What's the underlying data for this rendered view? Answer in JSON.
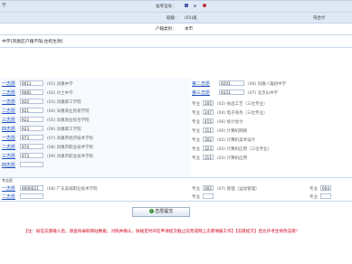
{
  "header": {
    "field1_suffix": "学",
    "exam_no_label": "准考证号：",
    "class_label": "班级：",
    "class_value": "(01)班",
    "hukou_label": "户籍类别：",
    "hukou_value": "本市",
    "subsidy_label": "符合计",
    "region_text": "中学(凤凰区户籍不限,住校生除)"
  },
  "tiers": [
    {
      "label": "一志愿",
      "code": "9011",
      "school": "(01) 凤凰中学"
    },
    {
      "label": "二志愿",
      "code": "9081",
      "school": "(02) 兴土中学"
    },
    {
      "label": "一志愿",
      "code": "920",
      "school": "(03) 凤凰职工学院"
    },
    {
      "label": "二志愿",
      "code": "921",
      "school": "(04) 凤凰商业贸易学院"
    },
    {
      "label": "三志愿",
      "code": "922",
      "school": "(05) 凤凰商业综合学院"
    },
    {
      "label": "四志愿",
      "code": "923",
      "school": "(06) 凤凰职工学院"
    },
    {
      "label": "一志愿",
      "code": "973",
      "school": "(07) 凤凰市经济技术学校"
    },
    {
      "label": "二志愿",
      "code": "974",
      "school": "(08) 凤凰市职业技术学校"
    },
    {
      "label": "三志愿",
      "code": "973",
      "school": "(09) 凤凰市职业技术学校"
    },
    {
      "label": "四志愿",
      "code": "",
      "school": ""
    }
  ],
  "right_tiers": [
    {
      "label": "第二志愿",
      "code": "9201",
      "school": "(06) 凤凰八雄初中学"
    },
    {
      "label": "第三志愿",
      "code": "9331",
      "school": "(07) 北京山中学"
    }
  ],
  "majors": [
    {
      "prefix": "专业",
      "num": "205",
      "name": "(02) 食品工艺（三位专业）"
    },
    {
      "prefix": "专业",
      "num": "247",
      "name": "(04) 电子商务（三位专业）"
    },
    {
      "prefix": "专业",
      "num": "415",
      "name": "(06) 统计会计"
    },
    {
      "prefix": "专业",
      "num": "311",
      "name": "(06) 计算机网络"
    },
    {
      "prefix": "专业",
      "num": "302",
      "name": "(02) 计算机美术设计"
    },
    {
      "prefix": "专业",
      "num": "323",
      "name": "(02) 计算机应用（三位专业）"
    },
    {
      "prefix": "专业",
      "num": "311",
      "name": "(03) 计算机应用"
    }
  ],
  "special": {
    "section_label": "专志愿",
    "tier_label": "一志愿",
    "code": "9000021",
    "school": "(08) 广东美城职业技术学院",
    "major_prefix": "专业",
    "major_num": "002",
    "major_name": "(07) 管理（运动管理）",
    "extra_prefix": "专业",
    "extra_num": "004",
    "second_tier_label": "二志愿",
    "second_prefix": "专业"
  },
  "submit_label": "志愿提交",
  "notice": "【注：如在志愿输入后，请查询录取网站数据，对照并确认，按规定时间在申请提交截止前完成网上志愿填报工作】【志愿提交】后允许考生修改志愿！"
}
